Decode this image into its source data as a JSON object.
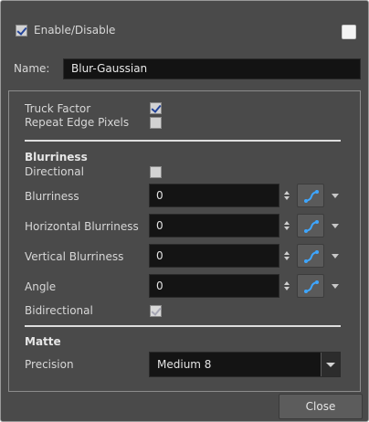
{
  "header": {
    "enable_label": "Enable/Disable",
    "enable_checked": true,
    "color_swatch": "#f4f4f4"
  },
  "name": {
    "label": "Name:",
    "value": "Blur-Gaussian"
  },
  "options": {
    "truck_factor": {
      "label": "Truck Factor",
      "checked": true
    },
    "repeat_edge": {
      "label": "Repeat Edge Pixels",
      "checked": false
    }
  },
  "blurriness_section": {
    "title": "Blurriness",
    "directional": {
      "label": "Directional",
      "checked": false
    },
    "fields": [
      {
        "label": "Blurriness",
        "value": "0"
      },
      {
        "label": "Horizontal Blurriness",
        "value": "0"
      },
      {
        "label": "Vertical Blurriness",
        "value": "0"
      },
      {
        "label": "Angle",
        "value": "0"
      }
    ],
    "bidirectional": {
      "label": "Bidirectional",
      "checked": true,
      "disabled": true
    }
  },
  "matte_section": {
    "title": "Matte",
    "precision": {
      "label": "Precision",
      "value": "Medium 8"
    }
  },
  "footer": {
    "close_label": "Close"
  },
  "icons": {
    "function_icon": "function-curve-icon",
    "spin_icon": "spin-arrows-icon",
    "dropdown_icon": "chevron-down-icon"
  },
  "colors": {
    "background": "#4a4a4a",
    "field_bg": "#141414",
    "check_blue": "#23449a",
    "function_icon": "#3ea6ff"
  }
}
